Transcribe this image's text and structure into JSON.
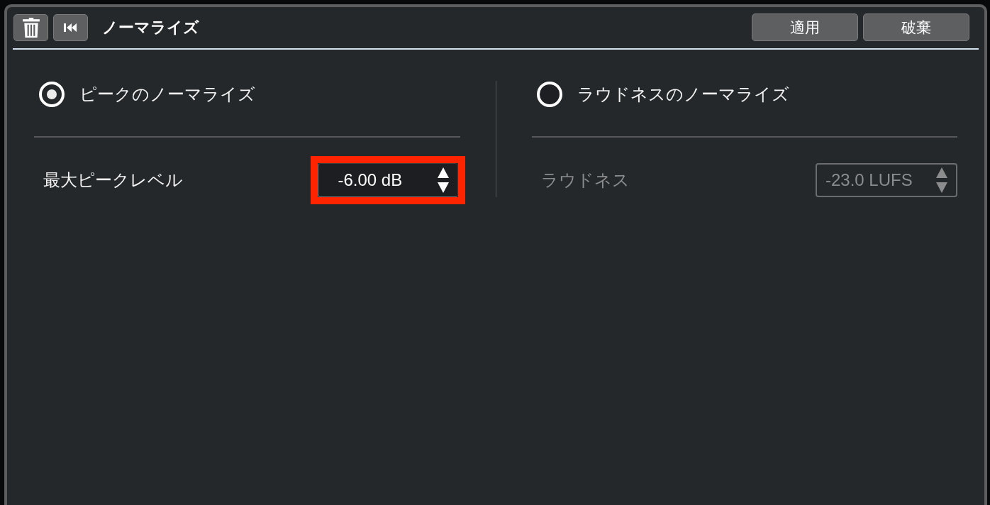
{
  "toolbar": {
    "title": "ノーマライズ",
    "buttons": [
      "適用",
      "破棄"
    ]
  },
  "sections": [
    {
      "option": {
        "label": "ピークのノーマライズ",
        "selected": true
      },
      "setting": {
        "label": "最大ピークレベル",
        "value": "-6.00 dB",
        "disabled": false,
        "highlighted": true
      }
    },
    {
      "option": {
        "label": "ラウドネスのノーマライズ",
        "selected": false
      },
      "setting": {
        "label": "ラウドネス",
        "value": "-23.0 LUFS",
        "disabled": true,
        "highlighted": false
      }
    }
  ]
}
